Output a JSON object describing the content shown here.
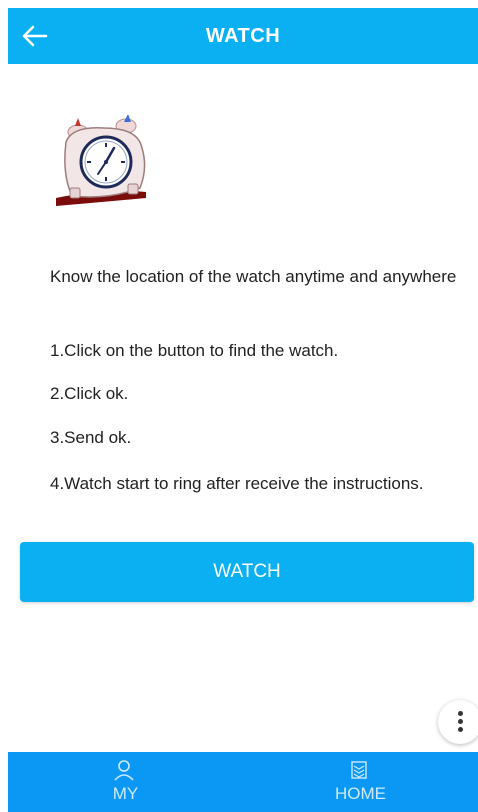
{
  "header": {
    "title": "WATCH"
  },
  "icons": {
    "back": "back-arrow-icon",
    "illustration": "alarm-clock-icon",
    "menu": "more-vertical-icon",
    "my": "person-icon",
    "home": "home-icon"
  },
  "content": {
    "intro": "Know the location of the watch anytime and anywhere",
    "step1": "1.Click on the button to find the watch.",
    "step2": "2.Click ok.",
    "step3": "3.Send ok.",
    "step4": "4.Watch start to ring after receive the instructions."
  },
  "main_button": {
    "label": "WATCH"
  },
  "bottom_nav": {
    "items": [
      {
        "label": "MY"
      },
      {
        "label": "HOME"
      }
    ]
  },
  "colors": {
    "header_bg": "#0ab0f2",
    "button_bg": "#0ab0f2",
    "nav_bg": "#0a98f4",
    "text": "#222222"
  }
}
